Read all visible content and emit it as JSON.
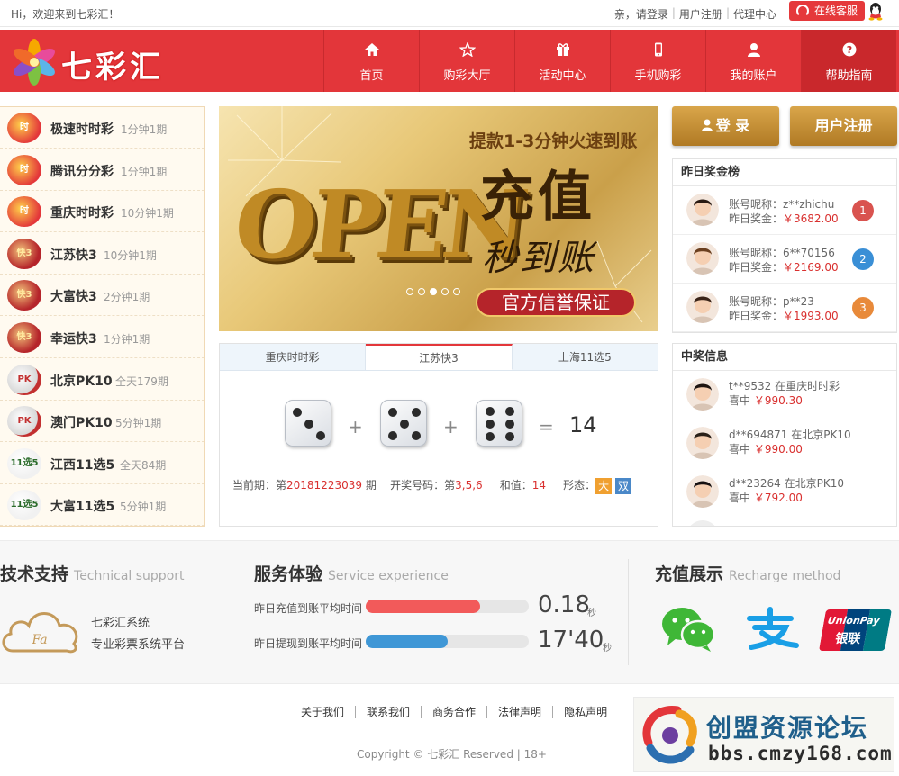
{
  "topbar": {
    "greeting": "Hi，欢迎来到七彩汇！",
    "prefix": "亲，",
    "login_link": "请登录",
    "register_link": "用户注册",
    "agent_link": "代理中心",
    "service": "在线客服"
  },
  "header": {
    "brand": "七彩汇",
    "nav": [
      {
        "label": "首页",
        "icon": "home-icon"
      },
      {
        "label": "购彩大厅",
        "icon": "star-icon"
      },
      {
        "label": "活动中心",
        "icon": "gift-icon"
      },
      {
        "label": "手机购彩",
        "icon": "phone-icon"
      },
      {
        "label": "我的账户",
        "icon": "user-icon"
      },
      {
        "label": "帮助指南",
        "icon": "help-icon"
      }
    ]
  },
  "games": [
    {
      "name": "极速时时彩",
      "freq": "1分钟1期",
      "icon": "ssc-icon"
    },
    {
      "name": "腾讯分分彩",
      "freq": "1分钟1期",
      "icon": "ssc-icon"
    },
    {
      "name": "重庆时时彩",
      "freq": "10分钟1期",
      "icon": "ssc-icon"
    },
    {
      "name": "江苏快3",
      "freq": "10分钟1期",
      "icon": "k3-icon"
    },
    {
      "name": "大富快3",
      "freq": "2分钟1期",
      "icon": "k3-icon"
    },
    {
      "name": "幸运快3",
      "freq": "1分钟1期",
      "icon": "k3-icon"
    },
    {
      "name": "北京PK10",
      "freq": "全天179期",
      "icon": "pk10-icon"
    },
    {
      "name": "澳门PK10",
      "freq": "5分钟1期",
      "icon": "pk10-icon"
    },
    {
      "name": "江西11选5",
      "freq": "全天84期",
      "icon": "11x5-icon"
    },
    {
      "name": "大富11选5",
      "freq": "5分钟1期",
      "icon": "11x5-icon"
    }
  ],
  "banner": {
    "headline": "提款1-3分钟火速到账",
    "main": "充值",
    "sub": "秒到账",
    "badge": "官方信誉保证",
    "open_text": "OPEN",
    "slides": 5,
    "active_slide": 3
  },
  "results": {
    "tabs": [
      "重庆时时彩",
      "江苏快3",
      "上海11选5"
    ],
    "active_tab": 1,
    "dice": [
      3,
      5,
      6
    ],
    "plus": "+",
    "equals": "=",
    "sum": "14",
    "period_label": "当前期：第",
    "period": "20181223039",
    "period_suffix": "期",
    "draw_label": "开奖号码：第",
    "draw": "3,5,6",
    "sum_label": "和值：",
    "shape_label": "形态：",
    "shape_big": "大",
    "shape_even": "双"
  },
  "account": {
    "login": "登 录",
    "register": "用户注册"
  },
  "rank": {
    "title": "昨日奖金榜",
    "nick_label": "账号昵称：",
    "prize_label": "昨日奖金：",
    "items": [
      {
        "nick": "z**zhichu",
        "prize": "￥3682.00",
        "rank": "1",
        "color": "#d9534f"
      },
      {
        "nick": "6**70156",
        "prize": "￥2169.00",
        "rank": "2",
        "color": "#3a8fd6"
      },
      {
        "nick": "p**23",
        "prize": "￥1993.00",
        "rank": "3",
        "color": "#e88a3a"
      }
    ]
  },
  "winners": {
    "title": "中奖信息",
    "prefix": "喜中",
    "items": [
      {
        "user": "t**9532",
        "game": "在重庆时时彩",
        "amount": "￥990.30"
      },
      {
        "user": "d**694871",
        "game": "在北京PK10",
        "amount": "￥990.00"
      },
      {
        "user": "d**23264",
        "game": "在北京PK10",
        "amount": "￥792.00"
      }
    ]
  },
  "tech": {
    "title": "技术支持",
    "title_en": "Technical support",
    "line1": "七彩汇系统",
    "line2": "专业彩票系统平台",
    "cloud_text": "Fa"
  },
  "service": {
    "title": "服务体验",
    "title_en": "Service experience",
    "metrics": [
      {
        "label": "昨日充值到账平均时间",
        "value": "0.18",
        "unit": "秒",
        "fill": 0.7,
        "color": "#f25a5a"
      },
      {
        "label": "昨日提现到账平均时间",
        "value": "17'40",
        "unit": "秒",
        "fill": 0.5,
        "color": "#3f97d6"
      }
    ]
  },
  "recharge": {
    "title": "充值展示",
    "title_en": "Recharge method",
    "unionpay_en": "UnionPay",
    "unionpay_cn": "银联"
  },
  "footer": {
    "links": [
      "关于我们",
      "联系我们",
      "商务合作",
      "法律声明",
      "隐私声明"
    ],
    "copyright": "Copyright © 七彩汇 Reserved | 18+"
  },
  "watermark": {
    "title": "创盟资源论坛",
    "url": "bbs.cmzy168.com"
  },
  "colors": {
    "brand_red": "#e3363a",
    "gold": "#c48e34",
    "price_red": "#d9302f"
  }
}
